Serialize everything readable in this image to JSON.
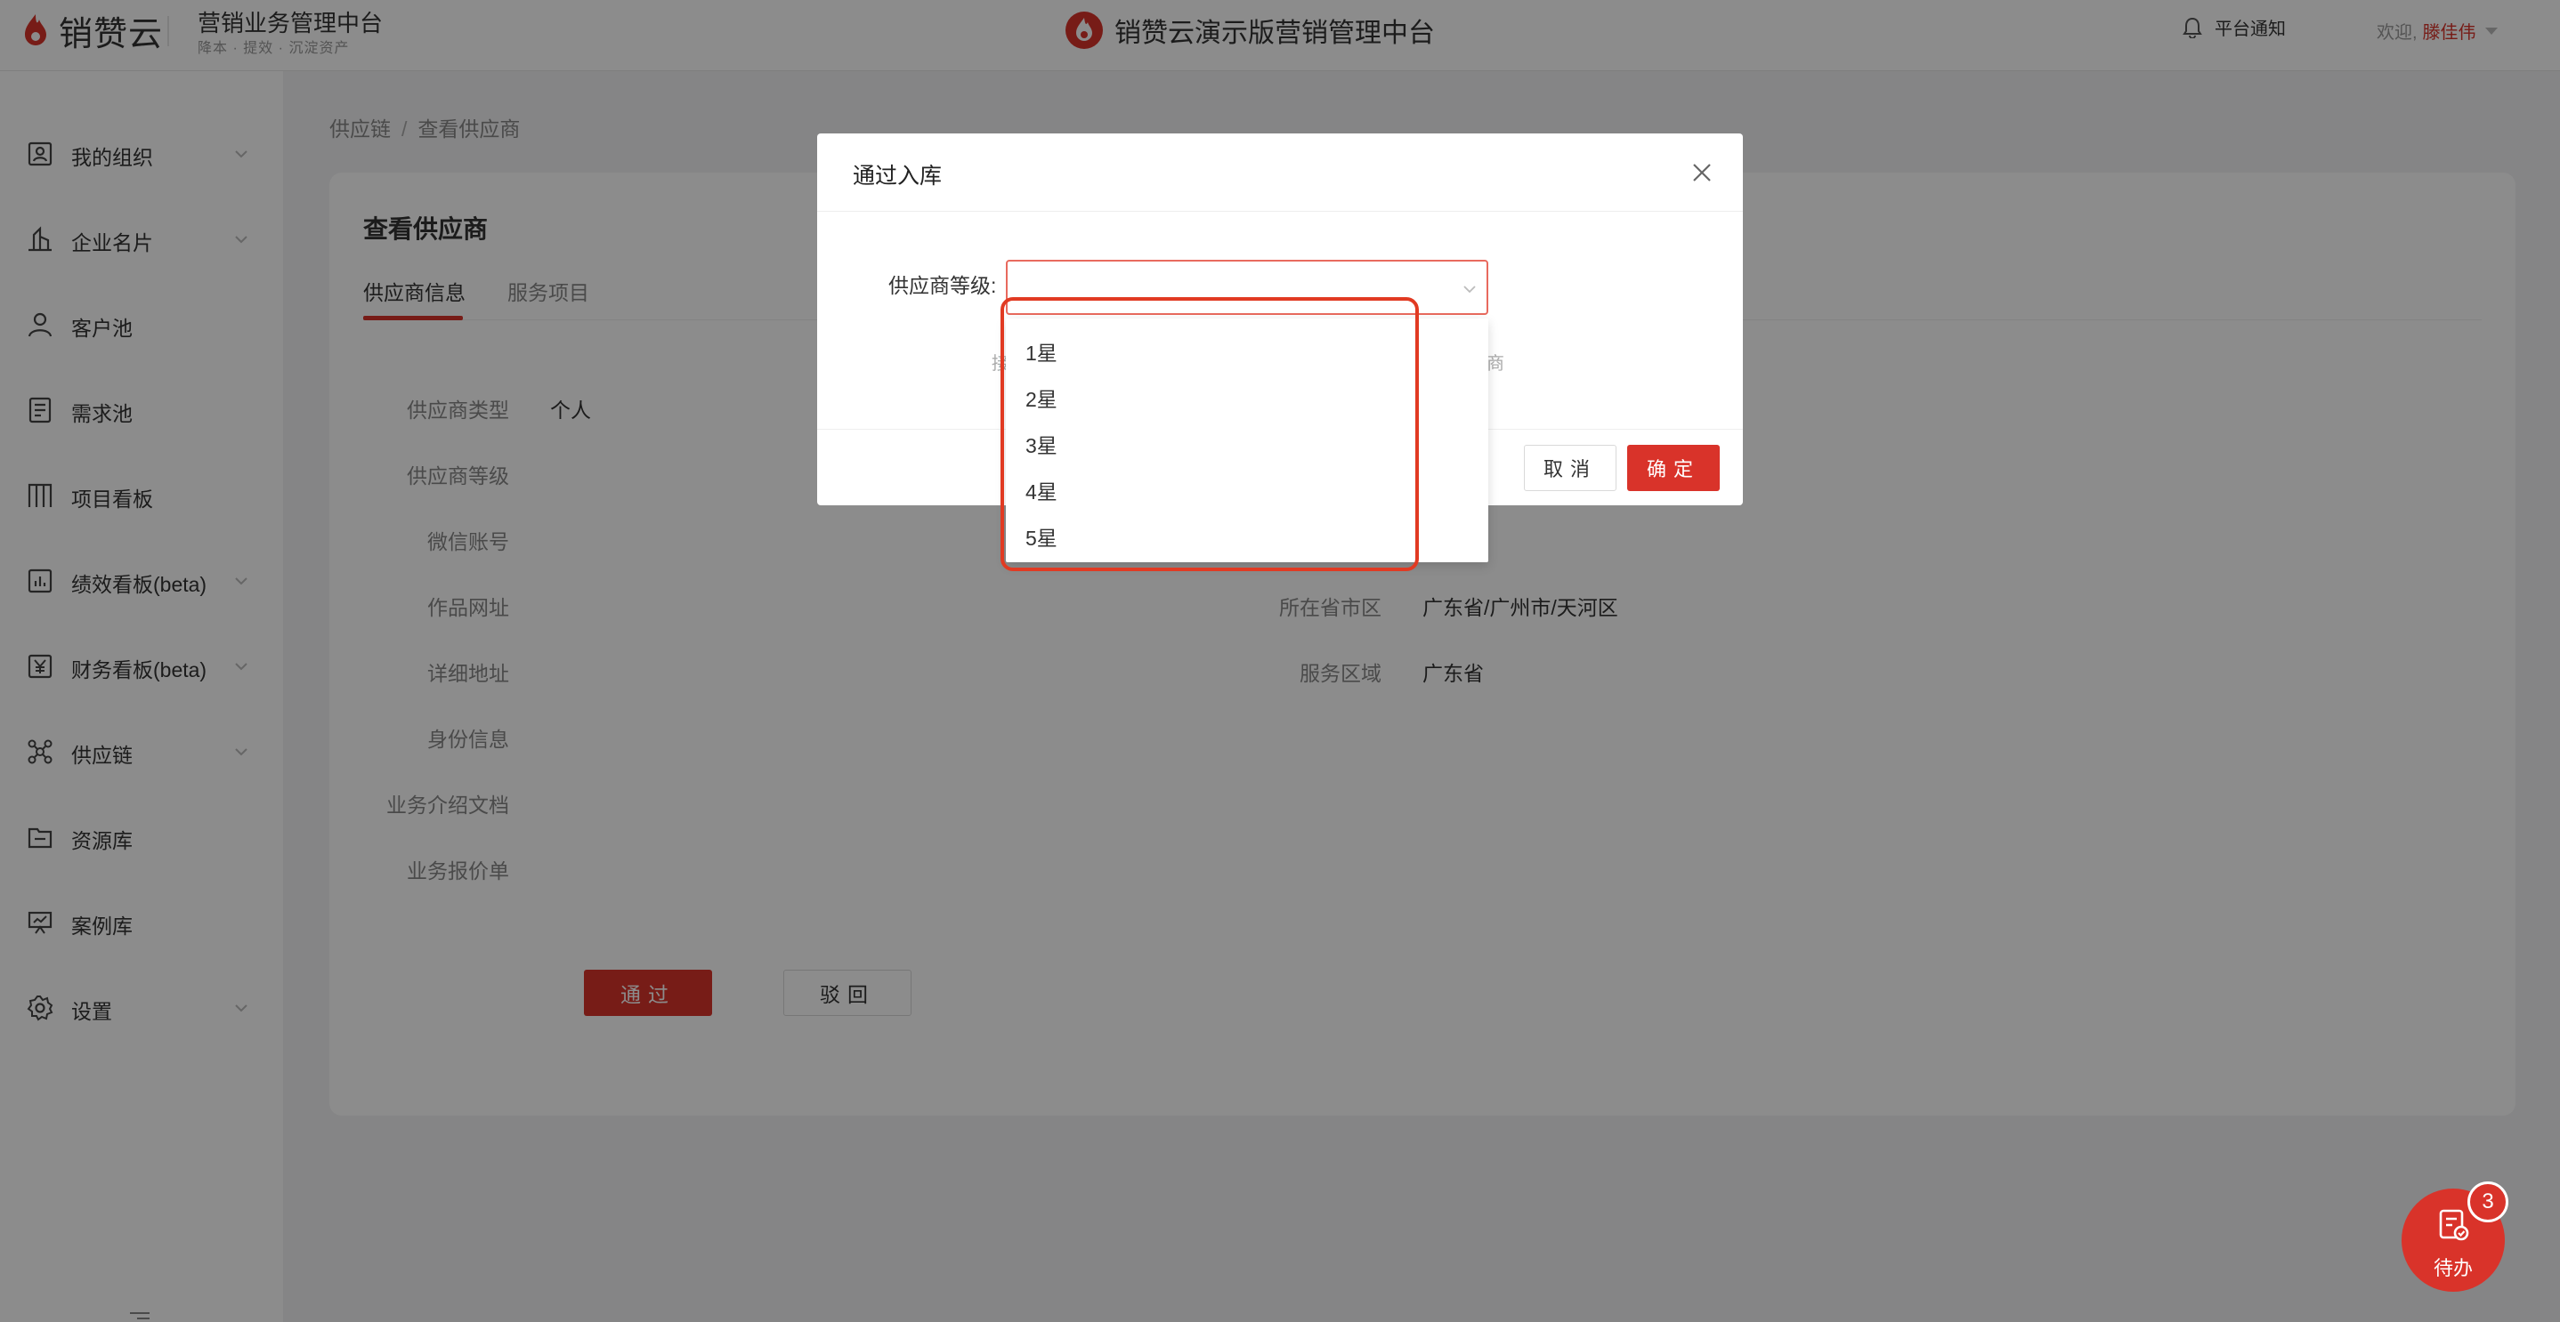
{
  "header": {
    "logo_text": "销赞云",
    "platform_title": "营销业务管理中台",
    "platform_subtitle": "降本 · 提效 · 沉淀资产",
    "center_title": "销赞云演示版营销管理中台",
    "notice_label": "平台通知",
    "welcome": "欢迎,",
    "username": "滕佳伟"
  },
  "sidebar": {
    "items": [
      {
        "label": "我的组织",
        "icon": "org-icon",
        "expandable": true
      },
      {
        "label": "企业名片",
        "icon": "building-icon",
        "expandable": true
      },
      {
        "label": "客户池",
        "icon": "user-icon",
        "expandable": false
      },
      {
        "label": "需求池",
        "icon": "document-icon",
        "expandable": false
      },
      {
        "label": "项目看板",
        "icon": "board-icon",
        "expandable": false
      },
      {
        "label": "绩效看板(beta)",
        "icon": "chart-icon",
        "expandable": true
      },
      {
        "label": "财务看板(beta)",
        "icon": "yen-icon",
        "expandable": true
      },
      {
        "label": "供应链",
        "icon": "network-icon",
        "expandable": true
      },
      {
        "label": "资源库",
        "icon": "folder-icon",
        "expandable": false
      },
      {
        "label": "案例库",
        "icon": "presentation-icon",
        "expandable": false
      },
      {
        "label": "设置",
        "icon": "gear-icon",
        "expandable": true
      }
    ]
  },
  "breadcrumb": {
    "root": "供应链",
    "sep": "/",
    "current": "查看供应商"
  },
  "page": {
    "title": "查看供应商",
    "tabs": [
      "供应商信息",
      "服务项目"
    ],
    "fields_left": [
      {
        "label": "供应商类型",
        "value": "个人"
      },
      {
        "label": "供应商等级",
        "value": ""
      },
      {
        "label": "微信账号",
        "value": ""
      },
      {
        "label": "作品网址",
        "value": ""
      },
      {
        "label": "详细地址",
        "value": ""
      },
      {
        "label": "身份信息",
        "value": ""
      },
      {
        "label": "业务介绍文档",
        "value": ""
      },
      {
        "label": "业务报价单",
        "value": ""
      }
    ],
    "fields_right": [
      {
        "label": "所在省市区",
        "value": "广东省/广州市/天河区"
      },
      {
        "label": "服务区域",
        "value": "广东省"
      }
    ],
    "pass_button": "通过",
    "reject_button": "驳回"
  },
  "modal": {
    "title": "通过入库",
    "level_label": "供应商等级:",
    "hint_left": "接",
    "hint_right": "商",
    "cancel": "取消",
    "ok": "确定",
    "options": [
      "1星",
      "2星",
      "3星",
      "4星",
      "5星"
    ]
  },
  "todo": {
    "label": "待办",
    "count": "3"
  },
  "colors": {
    "accent": "#d9332a",
    "highlight": "#e13a22"
  }
}
